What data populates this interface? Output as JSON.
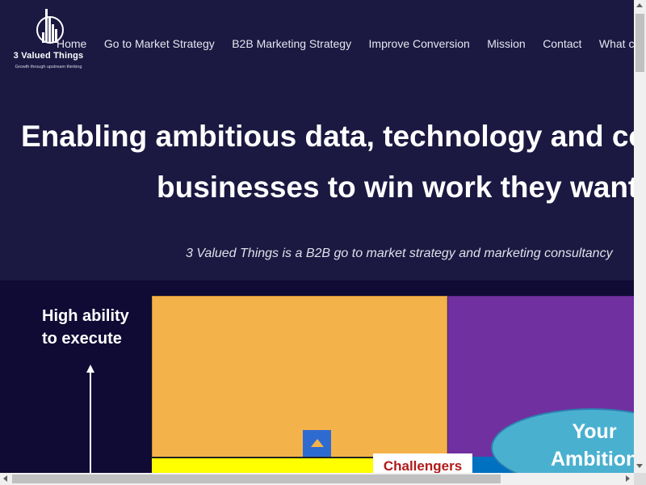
{
  "brand": {
    "name": "3 Valued Things",
    "tagline": "Growth through upstream thinking",
    "logo_icon": "building-bars-icon"
  },
  "nav": {
    "items": [
      {
        "label": "Home"
      },
      {
        "label": "Go to Market Strategy"
      },
      {
        "label": "B2B Marketing Strategy"
      },
      {
        "label": "Improve Conversion"
      },
      {
        "label": "Mission"
      },
      {
        "label": "Contact"
      },
      {
        "label": "What clie"
      }
    ]
  },
  "hero": {
    "headline_line1": "Enabling ambitious data, technology and cons",
    "headline_line2": "businesses to win work they want",
    "subheadline": "3 Valued Things is a B2B go to market strategy and marketing consultancy"
  },
  "matrix": {
    "axis_label_line1": "High ability",
    "axis_label_line2": "to execute",
    "challengers_label": "Challengers",
    "ambition_line1": "Your",
    "ambition_line2": "Ambition",
    "colors": {
      "background": "#0f0b35",
      "orange_quadrant": "#f4b24b",
      "purple_quadrant": "#7030a0",
      "yellow": "#ffff00",
      "blue": "#0070c0",
      "ellipse": "#4ab0d0",
      "challengers_text": "#b01a1a"
    }
  },
  "theme": {
    "page_background": "#1b1841"
  }
}
